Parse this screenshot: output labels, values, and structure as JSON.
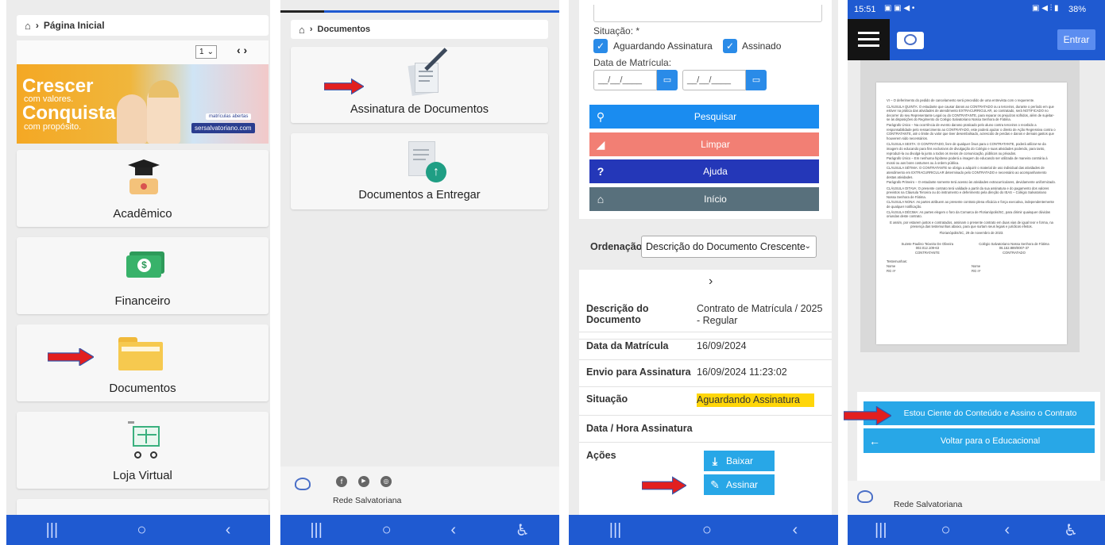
{
  "panel1": {
    "breadcrumb": "Página Inicial",
    "selector": "1",
    "banner": {
      "line1": "Crescer",
      "line2": "com valores.",
      "line3": "Conquistar",
      "line4": "com propósito.",
      "badge": "matrículas abertas",
      "url": "sersalvatoriano.com"
    },
    "menu": [
      {
        "label": "Acadêmico"
      },
      {
        "label": "Financeiro"
      },
      {
        "label": "Documentos"
      },
      {
        "label": "Loja Virtual"
      }
    ]
  },
  "panel2": {
    "breadcrumb": "Documentos",
    "cards": [
      {
        "label": "Assinatura de Documentos"
      },
      {
        "label": "Documentos a Entregar"
      }
    ],
    "footer": "Rede Salvatoriana"
  },
  "panel3": {
    "situacao_label": "Situação: *",
    "check1": "Aguardando Assinatura",
    "check2": "Assinado",
    "data_label": "Data de Matrícula:",
    "date_placeholder": "__/__/____",
    "buttons": {
      "pesquisar": "Pesquisar",
      "limpar": "Limpar",
      "ajuda": "Ajuda",
      "inicio": "Início"
    },
    "ordenacao_label": "Ordenação",
    "ordenacao_value": "Descrição do Documento Crescente",
    "rows": [
      {
        "k": "Descrição do Documento",
        "v": "Contrato de Matrícula / 2025 - Regular"
      },
      {
        "k": "Data da Matrícula",
        "v": "16/09/2024"
      },
      {
        "k": "Envio para Assinatura",
        "v": "16/09/2024 11:23:02"
      },
      {
        "k": "Situação",
        "v": "Aguardando Assinatura"
      },
      {
        "k": "Data / Hora Assinatura",
        "v": ""
      },
      {
        "k": "Ações",
        "v": ""
      }
    ],
    "baixar": "Baixar",
    "assinar": "Assinar"
  },
  "panel4": {
    "status_time": "15:51",
    "status_battery": "38%",
    "entrar": "Entrar",
    "doc": {
      "p1": "VI – O deferimento do pedido de cancelamento será precedido de uma entrevista com o requerente.",
      "p2": "CLÁUSULA QUINTA: O estudante que causar danos ao CONTRATADO ou a terceiros, durante o período em que estiver na prática das atividades de atendimento EXTRACURRICULAR, ao contratado, será NOTIFICADO no decorrer do seu Representante Legal ou do CONTRATANTE, para reparar os prejuízos sofridos, além de sujeitar-se às disposições do Regimento do Colégio Salvatoriano Nossa Senhora de Fátima.",
      "p3": "Parágrafo Único – Na ocorrência de evento danoso praticado pelo aluno contra terceiros o recebido a responsabilidade pelo ressarcimento ao CONTRATADO, este poderá ajuizar o direito de Ação Regressiva contra o CONTRATANTE, até o limite do valor que tiver desembolsado, acrescido de perdas e danos e demais gastos que houverem sido necessários.",
      "p4": "CLÁUSULA SEXTA: O CONTRATADO, livre de qualquer ônus para o CONTRATANTE, poderá utilizar-se da imagem do educando para fins exclusivos de divulgação do Colégio e suas atividades podendo, para tanto, reproduzi-la ou divulgá-la junto a todos os meios de comunicação, públicos ou privados.",
      "p5": "Parágrafo Único – Em nenhuma hipótese poderá a imagem do educando ser utilizada de maneira contrária à moral ou aos bons costumes ou à ordem pública.",
      "p6": "CLÁUSULA SÉTIMA: O CONTRATANTE se obriga a adquirir o material de uso individual das atividades de atendimento em EXTRACURRICULAR determinado pelo CONTRATADO e necessário ao acompanhamento destas atividades.",
      "p7": "Parágrafo Primeiro – O estudante somente terá acesso às atividades extracurriculares, devidamente uniformizado.",
      "p8": "CLÁUSULA OITAVA: O presente contrato terá validade a partir da sua assinatura e do pagamento dos valores previstos na Cláusula Terceira ou do instrumento e deferimento pela direção do IEAS – Colégio Salvatoriano Nossa Senhora de Fátima.",
      "p9": "CLÁUSULA NONA: As partes atribuem ao presente contrato plena eficácia e força executiva, independentemente de qualquer notificação.",
      "p10": "CLÁUSULA DÉCIMA: As partes elegem o foro da Comarca de Florianópolis/SC, para dirimir quaisquer dúvidas oriundas deste contrato.",
      "p11": "E assim, por estarem justos e contratados, assinam o presente contrato em duas vias de igual teor e forma, na presença das testemunhas abaixo, para que surtam seus legais e jurídicos efeitos.",
      "place_date": "Florianópolis/SC, 29 de novembro de 2023.",
      "sig1_name": "Suzete Paulino Teixeira De Oliveira",
      "sig1_id": "002.012.109-63",
      "sig1_role": "CONTRATANTE",
      "sig2_name": "Colégio Salvatoriano Nossa Senhora de Fátima",
      "sig2_id": "06.152.889/0007-37",
      "sig2_role": "CONTRATADO",
      "witnesses": "Testemunhas:",
      "w_name": "Nome",
      "w_rg": "RG nº"
    },
    "btn_ciente": "Estou Ciente do Conteúdo e Assino o Contrato",
    "btn_voltar": "Voltar para o Educacional",
    "footer": "Rede Salvatoriana"
  },
  "colors": {
    "navbar": "#1f5ad1",
    "pesquisar": "#1a8cf0",
    "limpar": "#f27f74",
    "ajuda": "#2437b8",
    "inicio": "#58707c",
    "action": "#28a7e7",
    "highlight": "#ffd60a",
    "arrow": "#e21f1f"
  }
}
